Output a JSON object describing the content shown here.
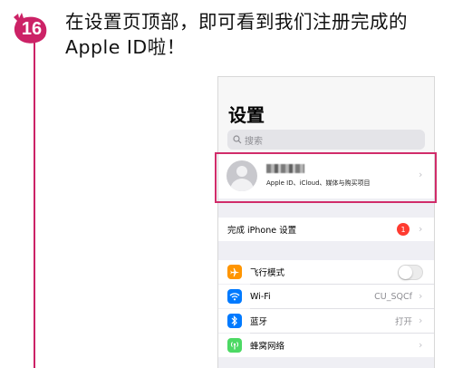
{
  "step": {
    "number": "16"
  },
  "instruction": {
    "text": "在设置页顶部，即可看到我们注册完成的Apple ID啦！"
  },
  "settings": {
    "title": "设置",
    "search_placeholder": "搜索",
    "profile": {
      "subtitle": "Apple ID、iCloud、媒体与购买项目"
    },
    "finish_setup": {
      "label": "完成 iPhone 设置",
      "badge": "1"
    },
    "rows": [
      {
        "label": "飞行模式",
        "icon": "airplane-icon",
        "color": "#ff9500"
      },
      {
        "label": "Wi-Fi",
        "value": "CU_SQCf",
        "icon": "wifi-icon",
        "color": "#007aff"
      },
      {
        "label": "蓝牙",
        "value": "打开",
        "icon": "bluetooth-icon",
        "color": "#007aff"
      },
      {
        "label": "蜂窝网络",
        "icon": "cellular-icon",
        "color": "#4cd964"
      }
    ]
  },
  "colors": {
    "accent": "#d12c6a",
    "badge_red": "#ff3b30"
  }
}
